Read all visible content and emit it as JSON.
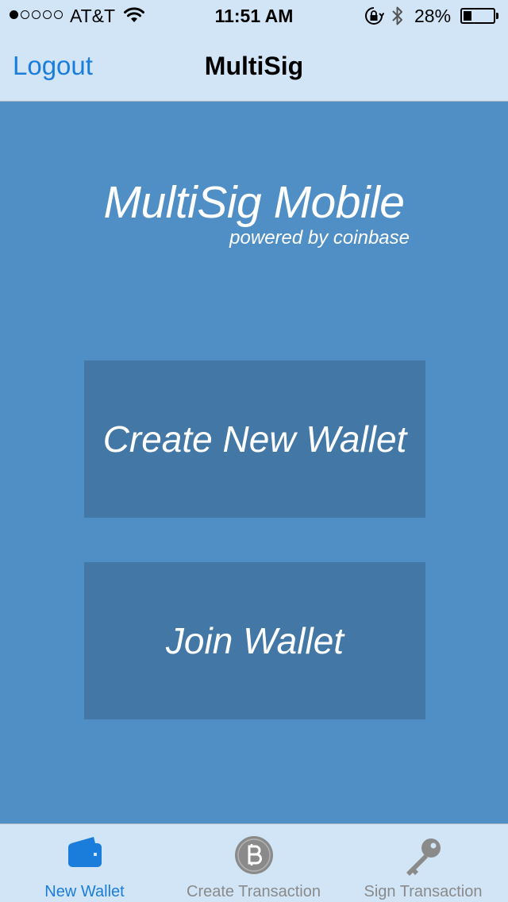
{
  "status_bar": {
    "carrier": "AT&T",
    "time": "11:51 AM",
    "battery_percent": "28%",
    "battery_level": 0.28,
    "signal_bars_filled": 1,
    "signal_bars_total": 5,
    "icons": [
      "wifi-icon",
      "rotation-lock-icon",
      "bluetooth-icon",
      "battery-icon"
    ]
  },
  "nav": {
    "left_button": "Logout",
    "title": "MultiSig"
  },
  "main": {
    "app_title": "MultiSig Mobile",
    "app_subtitle": "powered by coinbase",
    "create_wallet_label": "Create New Wallet",
    "join_wallet_label": "Join Wallet"
  },
  "tabs": [
    {
      "label": "New Wallet",
      "icon": "wallet-icon",
      "selected": true
    },
    {
      "label": "Create Transaction",
      "icon": "bitcoin-icon",
      "selected": false
    },
    {
      "label": "Sign Transaction",
      "icon": "key-icon",
      "selected": false
    }
  ],
  "colors": {
    "background": "#508fc5",
    "tile": "#4377a5",
    "bars": "#d1e5f6",
    "accent": "#1a7ddb",
    "inactive": "#8a8a8a"
  }
}
